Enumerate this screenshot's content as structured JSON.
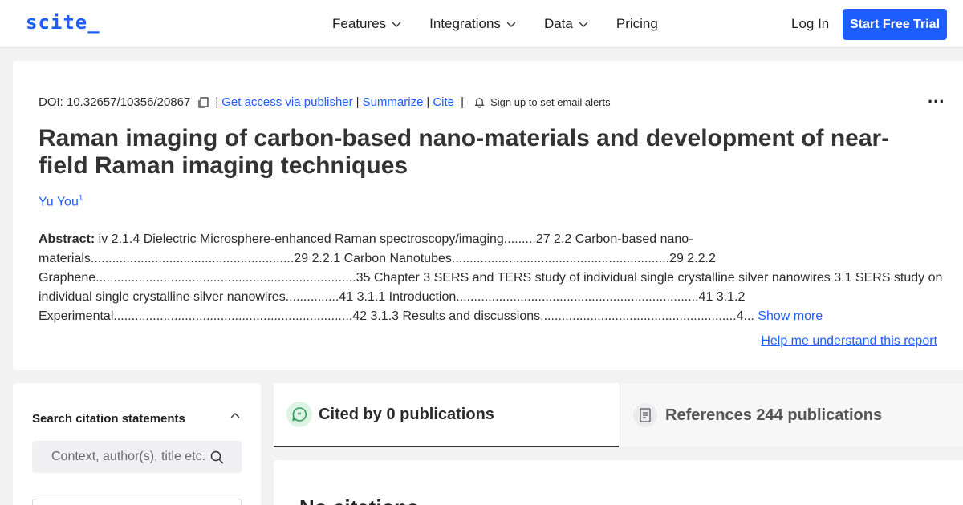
{
  "header": {
    "logo": "scite_",
    "nav": [
      {
        "label": "Features",
        "has_dropdown": true
      },
      {
        "label": "Integrations",
        "has_dropdown": true
      },
      {
        "label": "Data",
        "has_dropdown": true
      },
      {
        "label": "Pricing",
        "has_dropdown": false
      }
    ],
    "login_label": "Log In",
    "trial_label": "Start Free Trial"
  },
  "paper": {
    "doi": "DOI: 10.32657/10356/20867",
    "links": {
      "access": "Get access via publisher",
      "summarize": "Summarize",
      "cite": "Cite"
    },
    "alert_text": "Sign up to set email alerts",
    "more_menu": "...",
    "title": "Raman imaging of carbon-based nano-materials and development of near-field Raman imaging techniques",
    "author": "Yu You",
    "author_affiliation": "1",
    "abstract_label": "Abstract:",
    "abstract_text": " iv 2.1.4 Dielectric Microsphere-enhanced Raman spectroscopy/imaging.........27 2.2 Carbon-based nano-materials.........................................................29 2.2.1 Carbon Nanotubes.............................................................29 2.2.2 Graphene.........................................................................35 Chapter 3 SERS and TERS study of individual single crystalline silver nanowires 3.1 SERS study on individual single crystalline silver nanowires...............41 3.1.1 Introduction....................................................................41 3.1.2 Experimental...................................................................42 3.1.3 Results and discussions.......................................................4...",
    "show_more": "Show more",
    "help_link": "Help me understand this report"
  },
  "sidebar": {
    "title": "Search citation statements",
    "search_placeholder": "Context, author(s), title etc."
  },
  "tabs": {
    "cited_by": "Cited by 0 publications",
    "references": "References 244 publications"
  },
  "results": {
    "heading": "No citations"
  },
  "colors": {
    "brand": "#1e5eff",
    "quote_bg": "#dff3e5",
    "quote_fg": "#2f9e5a"
  }
}
